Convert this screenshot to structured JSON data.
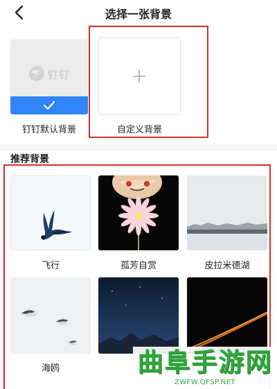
{
  "header": {
    "title": "选择一张背景"
  },
  "top": {
    "default_logo_text": "钉钉",
    "default_label": "钉钉默认背景",
    "custom_label": "自定义背景"
  },
  "recommended": {
    "title": "推荐背景",
    "items": [
      {
        "label": "飞行",
        "icon": "bird-in-flight"
      },
      {
        "label": "孤芳自赏",
        "icon": "flower-on-black"
      },
      {
        "label": "皮拉米德湖",
        "icon": "misty-lake"
      },
      {
        "label": "海鸥",
        "icon": "seagulls"
      },
      {
        "label": "",
        "icon": "night-mountains"
      },
      {
        "label": "",
        "icon": "light-trail"
      }
    ]
  },
  "watermark": {
    "title": "曲阜手游网",
    "url": "ZWFW.QFSP.NET"
  },
  "colors": {
    "accent": "#2f85f6",
    "highlight": "#d2302c",
    "watermark": "#2fa83a"
  }
}
